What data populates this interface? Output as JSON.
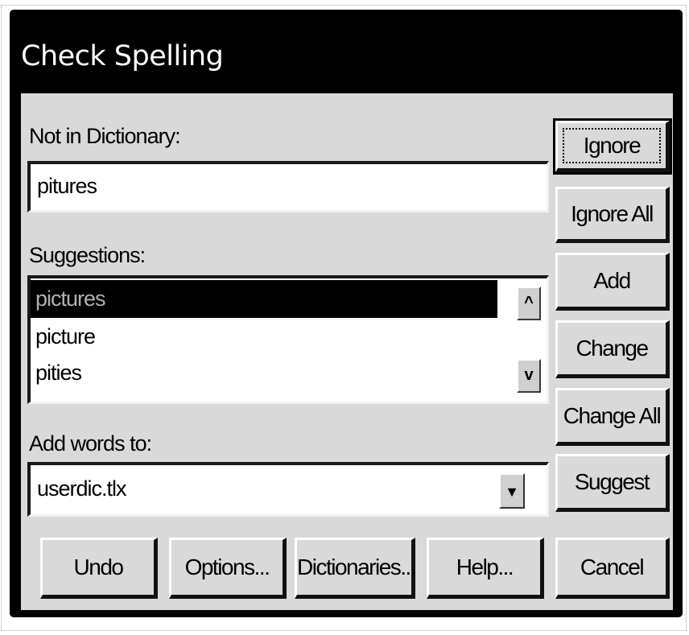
{
  "dialog": {
    "title": "Check Spelling"
  },
  "not_in_dictionary": {
    "label": "Not in Dictionary:",
    "value": "pitures"
  },
  "suggestions": {
    "label": "Suggestions:",
    "items": [
      "pictures",
      "picture",
      "pities"
    ],
    "selected_index": 0,
    "scroll_up_glyph": "^",
    "scroll_down_glyph": "v"
  },
  "add_words": {
    "label": "Add words to:",
    "value": "userdic.tlx",
    "arrow_glyph": "▼"
  },
  "side_buttons": {
    "ignore": "Ignore",
    "ignore_all": "Ignore All",
    "add": "Add",
    "change": "Change",
    "change_all": "Change All",
    "suggest": "Suggest",
    "cancel": "Cancel"
  },
  "bottom_buttons": {
    "undo": "Undo",
    "options": "Options...",
    "dictionaries": "Dictionaries...",
    "help": "Help..."
  },
  "icons": {
    "scroll_up": "chevron-up-icon",
    "scroll_down": "chevron-down-icon",
    "dropdown": "dropdown-arrow-icon"
  },
  "colors": {
    "titlebar": "#000000",
    "panel": "#d9d9d9",
    "selection": "#000000"
  }
}
